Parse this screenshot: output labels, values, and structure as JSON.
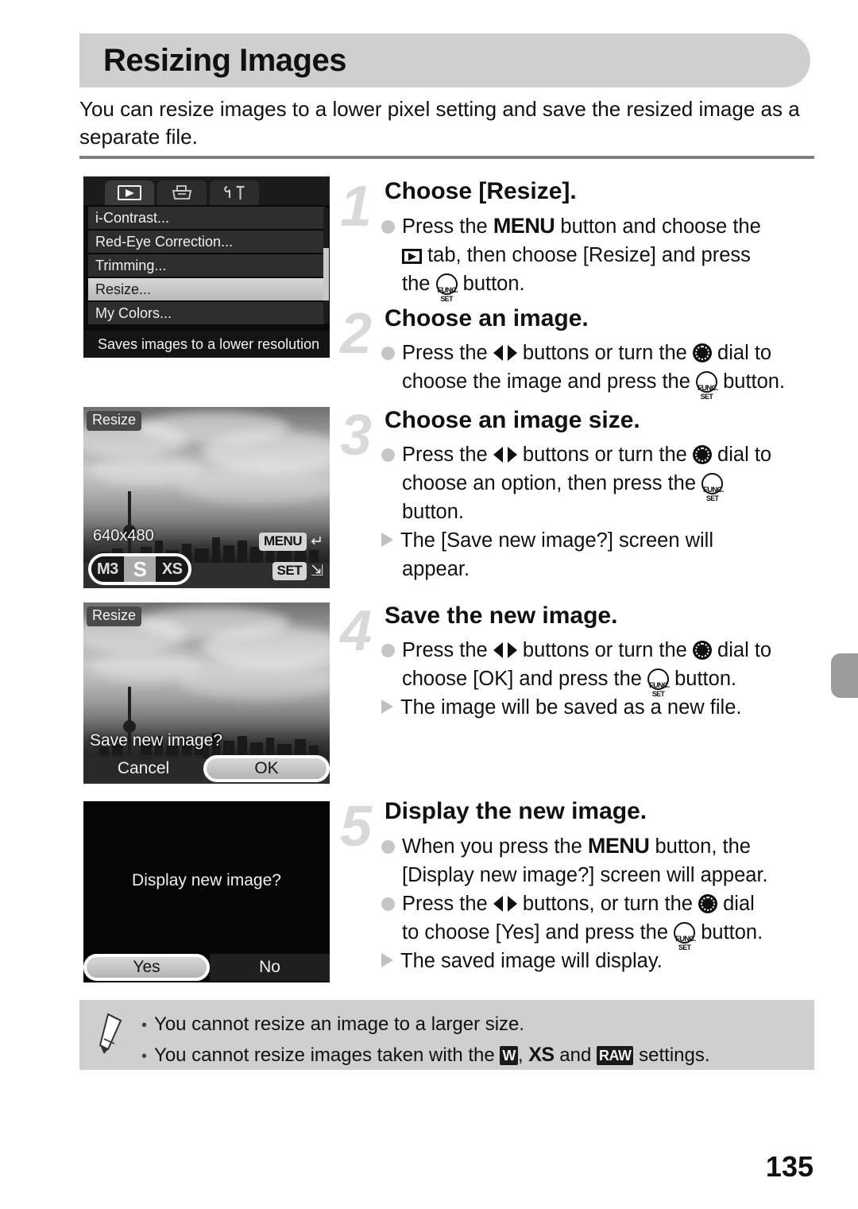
{
  "page": {
    "title": "Resizing Images",
    "intro": "You can resize images to a lower pixel setting and save the resized image as a separate file.",
    "page_number": "135"
  },
  "menu_screen": {
    "tabs": [
      "playback-tab",
      "print-tab",
      "settings-tab"
    ],
    "items": [
      "i-Contrast...",
      "Red-Eye Correction...",
      "Trimming...",
      "Resize...",
      "My Colors..."
    ],
    "selected_item": "Resize...",
    "hint": "Saves images to a lower resolution"
  },
  "size_screen": {
    "badge": "Resize",
    "resolution": "640x480",
    "options": [
      "M3",
      "S",
      "XS"
    ],
    "selected_option": "S",
    "hint_menu_key": "MENU",
    "hint_menu_icon": "return-arrow-icon",
    "hint_set_key": "SET",
    "hint_set_icon": "next-screen-icon"
  },
  "save_screen": {
    "badge": "Resize",
    "question": "Save new image?",
    "buttons": [
      "Cancel",
      "OK"
    ],
    "selected_button": "OK"
  },
  "display_screen": {
    "question": "Display new image?",
    "buttons": [
      "Yes",
      "No"
    ],
    "selected_button": "Yes"
  },
  "steps": [
    {
      "number": "1",
      "heading": "Choose [Resize].",
      "lines": [
        {
          "bullet": "dot",
          "parts": [
            {
              "t": "text",
              "v": "Press the "
            },
            {
              "t": "icon",
              "v": "menu-glyph"
            },
            {
              "t": "text",
              "v": " button and choose the"
            }
          ]
        },
        {
          "bullet": "none",
          "parts": [
            {
              "t": "icon",
              "v": "playback-glyph"
            },
            {
              "t": "text",
              "v": " tab, then choose [Resize] and press"
            }
          ]
        },
        {
          "bullet": "none",
          "parts": [
            {
              "t": "text",
              "v": "the "
            },
            {
              "t": "icon",
              "v": "func-set-glyph"
            },
            {
              "t": "text",
              "v": " button."
            }
          ]
        }
      ]
    },
    {
      "number": "2",
      "heading": "Choose an image.",
      "lines": [
        {
          "bullet": "dot",
          "parts": [
            {
              "t": "text",
              "v": "Press the "
            },
            {
              "t": "icon",
              "v": "left-right-glyph"
            },
            {
              "t": "text",
              "v": " buttons or turn the "
            },
            {
              "t": "icon",
              "v": "dial-glyph"
            },
            {
              "t": "text",
              "v": " dial to"
            }
          ]
        },
        {
          "bullet": "none",
          "parts": [
            {
              "t": "text",
              "v": "choose the image and press the "
            },
            {
              "t": "icon",
              "v": "func-set-glyph"
            },
            {
              "t": "text",
              "v": " button."
            }
          ]
        }
      ]
    },
    {
      "number": "3",
      "heading": "Choose an image size.",
      "lines": [
        {
          "bullet": "dot",
          "parts": [
            {
              "t": "text",
              "v": "Press the "
            },
            {
              "t": "icon",
              "v": "left-right-glyph"
            },
            {
              "t": "text",
              "v": " buttons or turn the "
            },
            {
              "t": "icon",
              "v": "dial-glyph"
            },
            {
              "t": "text",
              "v": " dial to"
            }
          ]
        },
        {
          "bullet": "none",
          "parts": [
            {
              "t": "text",
              "v": "choose an option, then press the "
            },
            {
              "t": "icon",
              "v": "func-set-glyph"
            }
          ]
        },
        {
          "bullet": "none",
          "parts": [
            {
              "t": "text",
              "v": "button."
            }
          ]
        },
        {
          "bullet": "tri",
          "parts": [
            {
              "t": "text",
              "v": "The [Save new image?] screen will"
            }
          ]
        },
        {
          "bullet": "none",
          "parts": [
            {
              "t": "text",
              "v": "appear."
            }
          ]
        }
      ]
    },
    {
      "number": "4",
      "heading": "Save the new image.",
      "lines": [
        {
          "bullet": "dot",
          "parts": [
            {
              "t": "text",
              "v": "Press the "
            },
            {
              "t": "icon",
              "v": "left-right-glyph"
            },
            {
              "t": "text",
              "v": " buttons or turn the "
            },
            {
              "t": "icon",
              "v": "dial-glyph"
            },
            {
              "t": "text",
              "v": " dial to"
            }
          ]
        },
        {
          "bullet": "none",
          "parts": [
            {
              "t": "text",
              "v": "choose [OK] and press the "
            },
            {
              "t": "icon",
              "v": "func-set-glyph"
            },
            {
              "t": "text",
              "v": " button."
            }
          ]
        },
        {
          "bullet": "tri",
          "parts": [
            {
              "t": "text",
              "v": "The image will be saved as a new file."
            }
          ]
        }
      ]
    },
    {
      "number": "5",
      "heading": "Display the new image.",
      "lines": [
        {
          "bullet": "dot",
          "parts": [
            {
              "t": "text",
              "v": "When you press the "
            },
            {
              "t": "icon",
              "v": "menu-glyph"
            },
            {
              "t": "text",
              "v": " button, the"
            }
          ]
        },
        {
          "bullet": "none",
          "parts": [
            {
              "t": "text",
              "v": "[Display new image?] screen will appear."
            }
          ]
        },
        {
          "bullet": "dot",
          "parts": [
            {
              "t": "text",
              "v": "Press the "
            },
            {
              "t": "icon",
              "v": "left-right-glyph"
            },
            {
              "t": "text",
              "v": " buttons, or turn the "
            },
            {
              "t": "icon",
              "v": "dial-glyph"
            },
            {
              "t": "text",
              "v": " dial"
            }
          ]
        },
        {
          "bullet": "none",
          "parts": [
            {
              "t": "text",
              "v": "to choose [Yes] and press the "
            },
            {
              "t": "icon",
              "v": "func-set-glyph"
            },
            {
              "t": "text",
              "v": " button."
            }
          ]
        },
        {
          "bullet": "tri",
          "parts": [
            {
              "t": "text",
              "v": "The saved image will display."
            }
          ]
        }
      ]
    }
  ],
  "note": {
    "lines": [
      {
        "parts": [
          {
            "t": "text",
            "v": "You cannot resize an image to a larger size."
          }
        ]
      },
      {
        "parts": [
          {
            "t": "text",
            "v": "You cannot resize images taken with the "
          },
          {
            "t": "boxicon",
            "v": "W"
          },
          {
            "t": "text",
            "v": ", "
          },
          {
            "t": "plainicon",
            "v": "XS"
          },
          {
            "t": "text",
            "v": " and "
          },
          {
            "t": "boxicon",
            "v": "RAW"
          },
          {
            "t": "text",
            "v": " settings."
          }
        ]
      }
    ]
  },
  "colors": {
    "banner": "#cfcfcf",
    "step_number": "#d9d9d9",
    "note_bg": "#cfcfcf",
    "thumb_tab": "#9b9b9b",
    "rule": "#808080"
  }
}
